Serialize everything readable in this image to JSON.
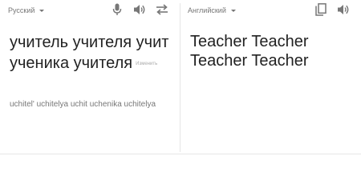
{
  "source": {
    "language": "Русский",
    "text": "учитель учителя учит ученика учителя",
    "edit_label": "Изменить",
    "transliteration": "uchitel' uchitelya uchit uchenika uchitelya",
    "icons": [
      "microphone-icon",
      "speaker-icon",
      "swap-icon"
    ]
  },
  "target": {
    "language": "Английский",
    "text": "Teacher Teacher Teacher Teacher",
    "icons": [
      "copy-icon",
      "speaker-icon"
    ]
  },
  "colors": {
    "icon": "#777777",
    "text": "#222222",
    "muted": "#777777",
    "divider": "#e6e6e6"
  }
}
